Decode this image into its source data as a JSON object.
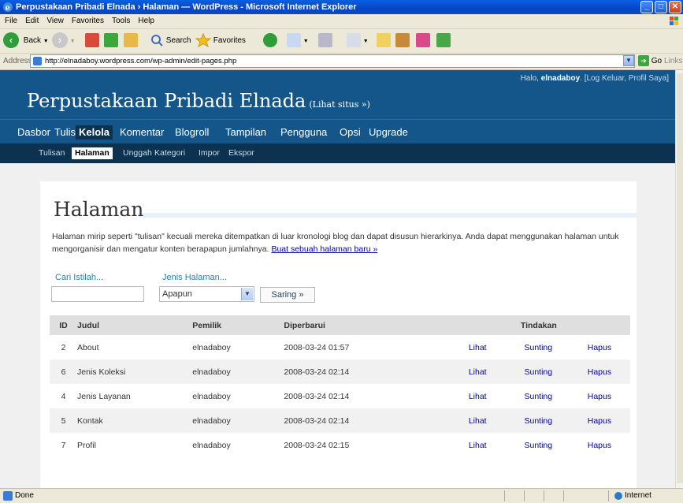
{
  "window": {
    "title": "Perpustakaan Pribadi Elnada › Halaman — WordPress - Microsoft Internet Explorer"
  },
  "menubar": [
    "File",
    "Edit",
    "View",
    "Favorites",
    "Tools",
    "Help"
  ],
  "toolbar": {
    "back": "Back",
    "search": "Search",
    "favorites": "Favorites"
  },
  "address": {
    "label": "Address",
    "url": "http://elnadaboy.wordpress.com/wp-admin/edit-pages.php",
    "go": "Go",
    "links": "Links"
  },
  "wp": {
    "blog_title": "Perpustakaan Pribadi Elnada",
    "view_site": "(Lihat situs »)",
    "greeting": "Halo, ",
    "username": "elnadaboy",
    "user_links": ". [Log Keluar, Profil Saya]",
    "menu": [
      "Dasbor",
      "Tulis",
      "Kelola",
      "Komentar",
      "Blogroll",
      "Tampilan",
      "Pengguna",
      "Opsi",
      "Upgrade"
    ],
    "menu_current": "Kelola",
    "submenu": [
      "Tulisan",
      "Halaman",
      "Unggah",
      "Kategori",
      "Impor",
      "Ekspor"
    ],
    "submenu_current": "Halaman"
  },
  "content": {
    "heading": "Halaman",
    "intro": "Halaman mirip seperti \"tulisan\" kecuali mereka ditempatkan di luar kronologi blog dan dapat disusun hierarkinya. Anda dapat menggunakan halaman untuk mengorganisir dan mengatur konten berapapun jumlahnya. ",
    "intro_link": "Buat sebuah halaman baru »",
    "search_label": "Cari Istilah...",
    "search_value": "",
    "type_label": "Jenis Halaman...",
    "type_value": "Apapun",
    "filter_button": "Saring »"
  },
  "table": {
    "headers": {
      "id": "ID",
      "title": "Judul",
      "owner": "Pemilik",
      "updated": "Diperbarui",
      "actions": "Tindakan"
    },
    "rows": [
      {
        "id": "2",
        "title": "About",
        "owner": "elnadaboy",
        "updated": "2008-03-24 01:57",
        "view": "Lihat",
        "edit": "Sunting",
        "delete": "Hapus"
      },
      {
        "id": "6",
        "title": "Jenis Koleksi",
        "owner": "elnadaboy",
        "updated": "2008-03-24 02:14",
        "view": "Lihat",
        "edit": "Sunting",
        "delete": "Hapus"
      },
      {
        "id": "4",
        "title": "Jenis Layanan",
        "owner": "elnadaboy",
        "updated": "2008-03-24 02:14",
        "view": "Lihat",
        "edit": "Sunting",
        "delete": "Hapus"
      },
      {
        "id": "5",
        "title": "Kontak",
        "owner": "elnadaboy",
        "updated": "2008-03-24 02:14",
        "view": "Lihat",
        "edit": "Sunting",
        "delete": "Hapus"
      },
      {
        "id": "7",
        "title": "Profil",
        "owner": "elnadaboy",
        "updated": "2008-03-24 02:15",
        "view": "Lihat",
        "edit": "Sunting",
        "delete": "Hapus"
      }
    ]
  },
  "status": {
    "left": "Done",
    "zone": "Internet"
  },
  "colors": {
    "wp_header": "#14568a",
    "wp_submenu": "#0d324f",
    "link": "#00019b",
    "label_blue": "#2583ad"
  }
}
